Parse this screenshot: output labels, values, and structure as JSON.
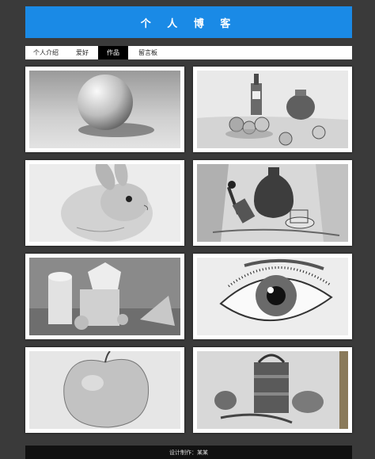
{
  "header": {
    "title": "个 人 博 客"
  },
  "nav": {
    "tabs": [
      {
        "label": "个人介绍"
      },
      {
        "label": "爱好"
      },
      {
        "label": "作品",
        "active": true
      },
      {
        "label": "留言板"
      }
    ]
  },
  "gallery": {
    "items": [
      {
        "subject": "sphere"
      },
      {
        "subject": "still-life-bottles-fruit"
      },
      {
        "subject": "rabbit"
      },
      {
        "subject": "still-life-vase-glass"
      },
      {
        "subject": "geometric-shapes"
      },
      {
        "subject": "eye"
      },
      {
        "subject": "apple"
      },
      {
        "subject": "still-life-pot-peppers"
      }
    ]
  },
  "footer": {
    "text": "设计制作：某某"
  },
  "colors": {
    "banner": "#1a8ae6",
    "background": "#3a3a3a",
    "footer": "#111111",
    "active_tab": "#000000"
  }
}
